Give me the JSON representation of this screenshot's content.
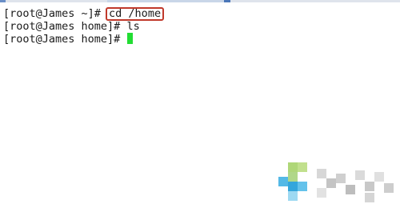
{
  "terminal": {
    "lines": [
      {
        "prompt": "[root@James ~]# ",
        "command": "cd /home"
      },
      {
        "prompt": "[root@James home]# ",
        "command": "ls"
      },
      {
        "prompt": "[root@James home]# ",
        "command": ""
      }
    ],
    "highlight_color": "#c0392b",
    "cursor_color": "#22dd33"
  },
  "watermark": {
    "icon": "blurred-watermark-logo",
    "colors": {
      "green": "#8dc63f",
      "blue": "#29a8e0",
      "gray": "#cfcfcf"
    }
  }
}
